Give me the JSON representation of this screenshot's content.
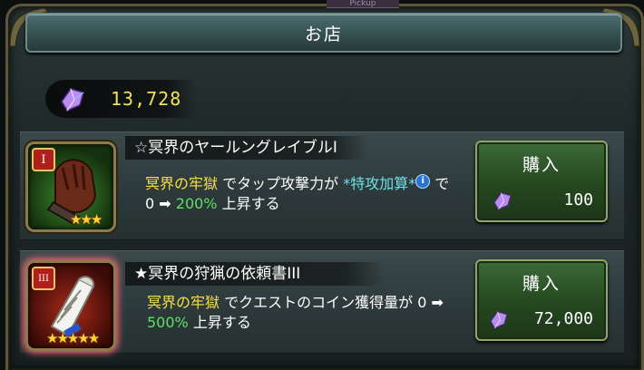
{
  "header": {
    "title": "お店",
    "pickup_label": "Pickup"
  },
  "wallet": {
    "amount": "13,728",
    "currency_icon": "crystal-icon"
  },
  "items": [
    {
      "rank": "I",
      "stars": "★★★",
      "icon": "glove-icon",
      "title": "☆冥界のヤールングレイブルI",
      "desc": {
        "place": "冥界の牢獄",
        "mid": " でタップ攻撃力が ",
        "bonus": "*特攻加算*",
        "tail_pre": " で 0 ➡ ",
        "pct": "200%",
        "tail": " 上昇する"
      },
      "buy_label": "購入",
      "price": "100"
    },
    {
      "rank": "III",
      "stars": "★★★★★",
      "icon": "scroll-icon",
      "title": "★冥界の狩猟の依頼書III",
      "desc": {
        "place": "冥界の牢獄",
        "mid": " でクエストのコイン獲得量が 0 ➡ ",
        "pct": "500%",
        "tail": " 上昇する"
      },
      "buy_label": "購入",
      "price": "72,000"
    }
  ],
  "colors": {
    "gold_text": "#f0e25a",
    "place_text": "#f4e042",
    "bonus_text": "#6fe0e8",
    "pct_text": "#5fe063",
    "buy_green": "#25471f"
  }
}
